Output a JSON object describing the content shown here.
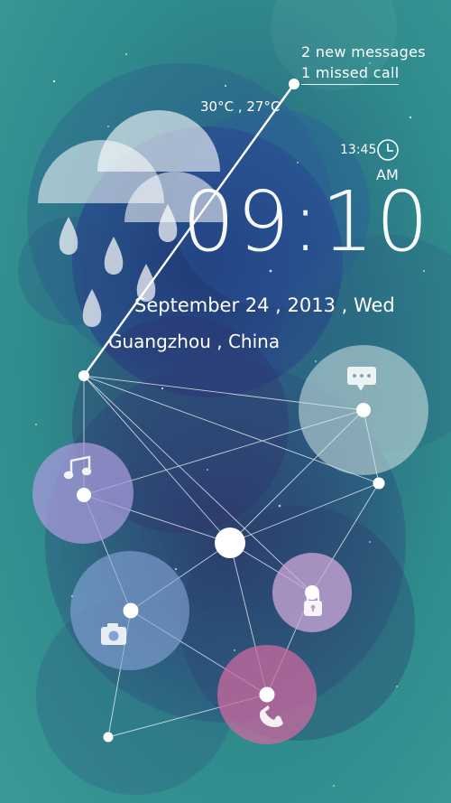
{
  "notifications": {
    "messages": "2 new messages",
    "calls": "1 missed call"
  },
  "weather": {
    "temperatures": "30°C , 27°C",
    "icon": "rain-cloud-icon"
  },
  "alarm": {
    "time": "13:45",
    "icon": "alarm-clock-icon"
  },
  "clock": {
    "time": "09:10",
    "period": "AM"
  },
  "date": "September 24 , 2013 , Wed",
  "location": "Guangzhou , China",
  "shortcuts": [
    {
      "name": "messages",
      "icon": "chat-bubble-icon",
      "color": "#c8dede"
    },
    {
      "name": "music",
      "icon": "music-note-icon",
      "color": "#9f93d4"
    },
    {
      "name": "camera",
      "icon": "camera-icon",
      "color": "#8aa7d6"
    },
    {
      "name": "unlock",
      "icon": "lock-icon",
      "color": "#c9a3d4"
    },
    {
      "name": "phone",
      "icon": "phone-icon",
      "color": "#c76a9c"
    }
  ],
  "colors": {
    "background": "#2f8a8c",
    "accent_white": "#ffffff"
  }
}
